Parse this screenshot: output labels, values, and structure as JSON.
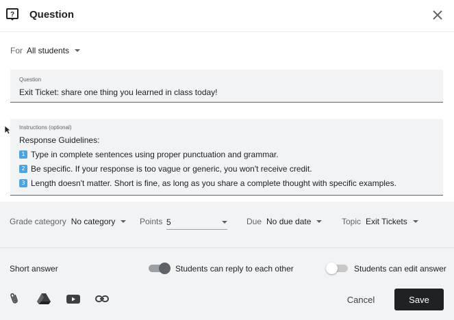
{
  "header": {
    "title": "Question",
    "question_icon": "question-box-icon",
    "close_icon": "close-icon"
  },
  "assign": {
    "label": "For",
    "value": "All students"
  },
  "question": {
    "label": "Question",
    "value": "Exit Ticket: share one thing you learned in class today!"
  },
  "instructions": {
    "label": "Instructions (optional)",
    "heading": "Response Guidelines:",
    "items": [
      {
        "num": "1",
        "text": "Type in complete sentences using proper punctuation and grammar."
      },
      {
        "num": "2",
        "text": "Be specific. If your response is too vague or generic, you won't receive credit."
      },
      {
        "num": "3",
        "text": "Length doesn't matter. Short is fine, as long as you share a complete thought with specific examples."
      }
    ]
  },
  "meta": {
    "grade_category": {
      "label": "Grade category",
      "value": "No category"
    },
    "points": {
      "label": "Points",
      "value": "5"
    },
    "due": {
      "label": "Due",
      "value": "No due date"
    },
    "topic": {
      "label": "Topic",
      "value": "Exit Tickets"
    }
  },
  "options": {
    "type": "Short answer",
    "reply_label": "Students can reply to each other",
    "reply_enabled": true,
    "edit_label": "Students can edit answer",
    "edit_enabled": false
  },
  "attachments": {
    "icons": [
      "paperclip-icon",
      "google-drive-icon",
      "youtube-icon",
      "link-icon"
    ]
  },
  "actions": {
    "cancel": "Cancel",
    "save": "Save"
  },
  "colors": {
    "field_bg": "#f1f3f4",
    "save_bg": "#202124",
    "badge": "#4da3e0"
  }
}
